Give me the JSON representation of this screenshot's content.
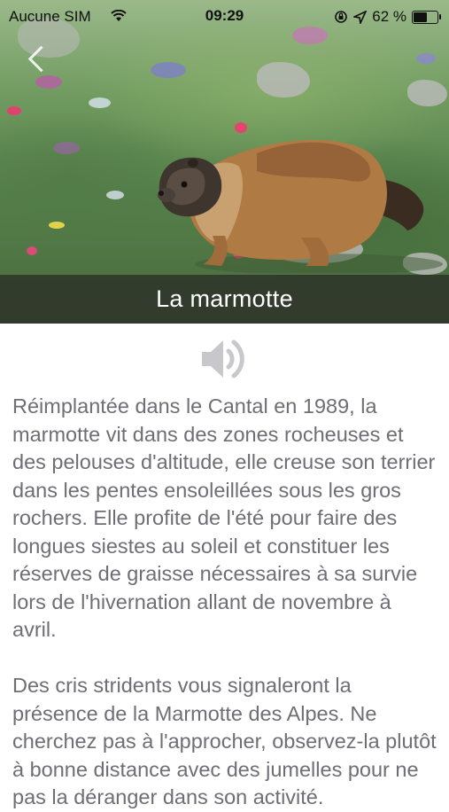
{
  "status_bar": {
    "carrier": "Aucune SIM",
    "time": "09:29",
    "battery_percent": "62 %",
    "battery_level": 0.62,
    "icons": [
      "wifi-icon",
      "rotation-lock-icon",
      "location-arrow-icon",
      "battery-icon"
    ]
  },
  "hero": {
    "title": "La marmotte",
    "back_icon": "chevron-left-icon"
  },
  "audio": {
    "icon": "speaker-icon"
  },
  "article": {
    "paragraphs": [
      "Réimplantée dans le Cantal en 1989, la marmotte vit dans des zones rocheuses et des pelouses d'altitude, elle creuse son terrier dans les pentes ensoleillées sous les gros rochers. Elle profite de l'été pour faire des longues siestes au soleil et constituer les réserves de graisse nécessaires à sa survie lors de l'hivernation allant de novembre à avril.",
      "Des cris stridents vous signaleront la présence de la Marmotte des Alpes. Ne cherchez pas à l'approcher, observez-la plutôt à bonne distance avec des jumelles pour ne pas la déranger dans son activité."
    ]
  },
  "colors": {
    "text": "#6e6e74",
    "title_bar": "#282826",
    "speaker": "#c8c8cc"
  }
}
